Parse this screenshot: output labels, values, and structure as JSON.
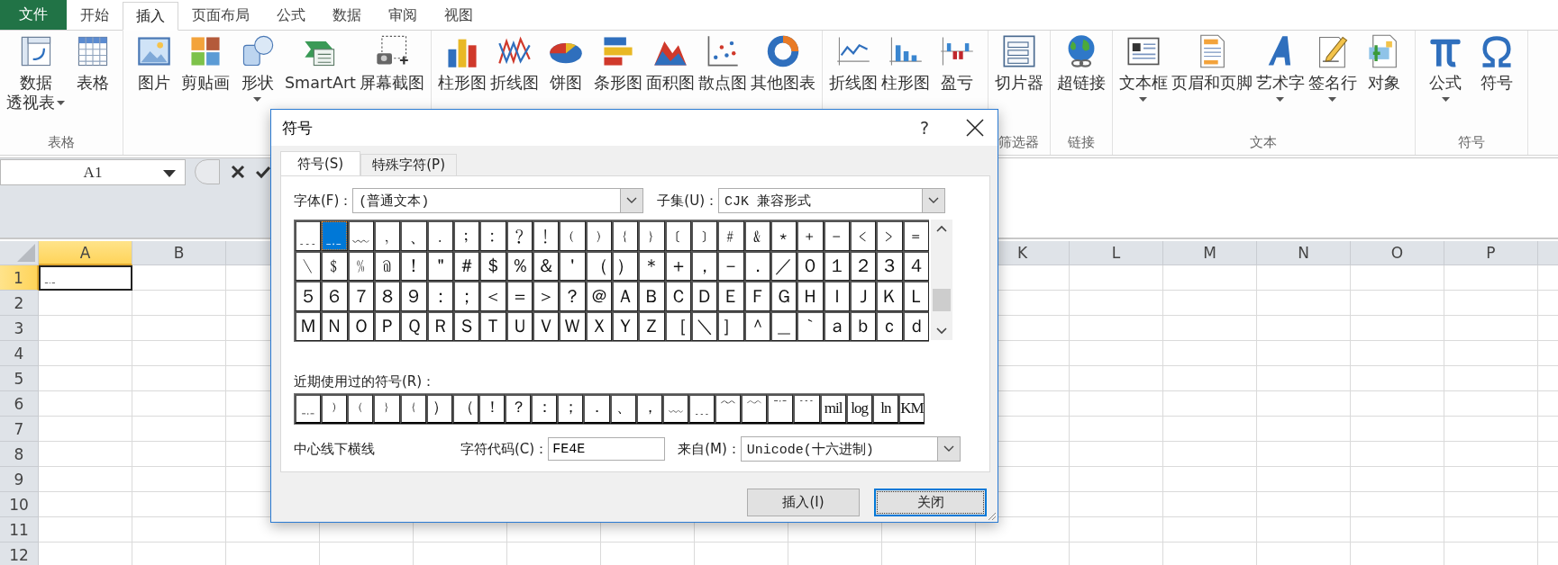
{
  "ribbon_tabs": [
    {
      "label": "文件",
      "kind": "file",
      "selected": false
    },
    {
      "label": "开始",
      "kind": "tab",
      "selected": false
    },
    {
      "label": "插入",
      "kind": "tab",
      "selected": true
    },
    {
      "label": "页面布局",
      "kind": "tab",
      "selected": false
    },
    {
      "label": "公式",
      "kind": "tab",
      "selected": false
    },
    {
      "label": "数据",
      "kind": "tab",
      "selected": false
    },
    {
      "label": "审阅",
      "kind": "tab",
      "selected": false
    },
    {
      "label": "视图",
      "kind": "tab",
      "selected": false
    }
  ],
  "ribbon_groups": [
    {
      "label": "表格",
      "items": [
        {
          "label": "数据",
          "label2": "透视表",
          "dropdown": true
        },
        {
          "label": "表格",
          "dropdown": false
        }
      ]
    },
    {
      "items": [
        {
          "label": "图片",
          "dropdown": false
        },
        {
          "label": "剪贴画",
          "dropdown": false
        },
        {
          "label": "形状",
          "dropdown": true
        },
        {
          "label": "SmartArt",
          "dropdown": false
        },
        {
          "label": "屏幕截图",
          "dropdown": false
        }
      ]
    },
    {
      "items": [
        {
          "label": "柱形图",
          "dropdown": false
        },
        {
          "label": "折线图",
          "dropdown": false
        },
        {
          "label": "饼图",
          "dropdown": false
        },
        {
          "label": "条形图",
          "dropdown": false
        },
        {
          "label": "面积图",
          "dropdown": false
        },
        {
          "label": "散点图",
          "dropdown": false
        },
        {
          "label": "其他图表",
          "dropdown": false
        }
      ]
    },
    {
      "items": [
        {
          "label": "折线图",
          "dropdown": false
        },
        {
          "label": "柱形图",
          "dropdown": false
        },
        {
          "label": "盈亏",
          "dropdown": false
        }
      ]
    },
    {
      "label": "筛选器",
      "items": [
        {
          "label": "切片器",
          "dropdown": false
        }
      ]
    },
    {
      "label": "链接",
      "items": [
        {
          "label": "超链接",
          "dropdown": false
        }
      ]
    },
    {
      "label": "文本",
      "items": [
        {
          "label": "文本框",
          "dropdown": true
        },
        {
          "label": "页眉和页脚",
          "dropdown": false
        },
        {
          "label": "艺术字",
          "dropdown": true
        },
        {
          "label": "签名行",
          "dropdown": true
        },
        {
          "label": "对象",
          "dropdown": false
        }
      ]
    },
    {
      "label": "符号",
      "items": [
        {
          "label": "公式",
          "dropdown": true
        },
        {
          "label": "符号",
          "dropdown": false
        }
      ]
    }
  ],
  "name_box": "A1",
  "sheet": {
    "columns_left": [
      {
        "label": "A",
        "selected": true
      },
      {
        "label": "B",
        "selected": false
      }
    ],
    "columns_right": [
      {
        "label": "K",
        "selected": false
      },
      {
        "label": "L",
        "selected": false
      },
      {
        "label": "M",
        "selected": false
      },
      {
        "label": "N",
        "selected": false
      },
      {
        "label": "O",
        "selected": false
      },
      {
        "label": "P",
        "selected": false
      }
    ],
    "rows": [
      {
        "label": "1",
        "selected": true,
        "cell_a": "﹎"
      },
      {
        "label": "2",
        "selected": false
      },
      {
        "label": "3",
        "selected": false
      },
      {
        "label": "4",
        "selected": false
      },
      {
        "label": "5",
        "selected": false
      },
      {
        "label": "6",
        "selected": false
      },
      {
        "label": "7",
        "selected": false
      },
      {
        "label": "8",
        "selected": false
      },
      {
        "label": "9",
        "selected": false
      },
      {
        "label": "10",
        "selected": false
      },
      {
        "label": "11",
        "selected": false
      },
      {
        "label": "12",
        "selected": false
      }
    ]
  },
  "dialog": {
    "title": "符号",
    "help": "?",
    "tabs": [
      {
        "label": "符号(S)",
        "selected": true
      },
      {
        "label": "特殊字符(P)",
        "selected": false
      }
    ],
    "font_label": "字体(F)：",
    "font_value": "(普通文本)",
    "subset_label": "子集(U)：",
    "subset_value": "CJK 兼容形式",
    "symbols": [
      {
        "c": "﹍",
        "selected": false
      },
      {
        "c": "﹎",
        "selected": true
      },
      {
        "c": "﹏",
        "selected": false
      },
      {
        "c": "﹐",
        "selected": false
      },
      {
        "c": "﹑",
        "selected": false
      },
      {
        "c": "﹒",
        "selected": false
      },
      {
        "c": "﹔",
        "selected": false
      },
      {
        "c": "﹕",
        "selected": false
      },
      {
        "c": "﹖",
        "selected": false
      },
      {
        "c": "﹗",
        "selected": false
      },
      {
        "c": "﹙",
        "selected": false
      },
      {
        "c": "﹚",
        "selected": false
      },
      {
        "c": "﹛",
        "selected": false
      },
      {
        "c": "﹜",
        "selected": false
      },
      {
        "c": "﹝",
        "selected": false
      },
      {
        "c": "﹞",
        "selected": false
      },
      {
        "c": "﹟",
        "selected": false
      },
      {
        "c": "﹠",
        "selected": false
      },
      {
        "c": "﹡",
        "selected": false
      },
      {
        "c": "﹢",
        "selected": false
      },
      {
        "c": "﹣",
        "selected": false
      },
      {
        "c": "﹤",
        "selected": false
      },
      {
        "c": "﹥",
        "selected": false
      },
      {
        "c": "﹦",
        "selected": false
      },
      {
        "c": "﹨",
        "selected": false
      },
      {
        "c": "﹩",
        "selected": false
      },
      {
        "c": "﹪",
        "selected": false
      },
      {
        "c": "﹫",
        "selected": false
      },
      {
        "c": "！",
        "selected": false
      },
      {
        "c": "＂",
        "selected": false
      },
      {
        "c": "＃",
        "selected": false
      },
      {
        "c": "＄",
        "selected": false
      },
      {
        "c": "％",
        "selected": false
      },
      {
        "c": "＆",
        "selected": false
      },
      {
        "c": "＇",
        "selected": false
      },
      {
        "c": "（",
        "selected": false
      },
      {
        "c": "）",
        "selected": false
      },
      {
        "c": "＊",
        "selected": false
      },
      {
        "c": "＋",
        "selected": false
      },
      {
        "c": "，",
        "selected": false
      },
      {
        "c": "－",
        "selected": false
      },
      {
        "c": "．",
        "selected": false
      },
      {
        "c": "／",
        "selected": false
      },
      {
        "c": "０",
        "selected": false
      },
      {
        "c": "１",
        "selected": false
      },
      {
        "c": "２",
        "selected": false
      },
      {
        "c": "３",
        "selected": false
      },
      {
        "c": "４",
        "selected": false
      },
      {
        "c": "５",
        "selected": false
      },
      {
        "c": "６",
        "selected": false
      },
      {
        "c": "７",
        "selected": false
      },
      {
        "c": "８",
        "selected": false
      },
      {
        "c": "９",
        "selected": false
      },
      {
        "c": "：",
        "selected": false
      },
      {
        "c": "；",
        "selected": false
      },
      {
        "c": "＜",
        "selected": false
      },
      {
        "c": "＝",
        "selected": false
      },
      {
        "c": "＞",
        "selected": false
      },
      {
        "c": "？",
        "selected": false
      },
      {
        "c": "＠",
        "selected": false
      },
      {
        "c": "Ａ",
        "selected": false
      },
      {
        "c": "Ｂ",
        "selected": false
      },
      {
        "c": "Ｃ",
        "selected": false
      },
      {
        "c": "Ｄ",
        "selected": false
      },
      {
        "c": "Ｅ",
        "selected": false
      },
      {
        "c": "Ｆ",
        "selected": false
      },
      {
        "c": "Ｇ",
        "selected": false
      },
      {
        "c": "Ｈ",
        "selected": false
      },
      {
        "c": "Ｉ",
        "selected": false
      },
      {
        "c": "Ｊ",
        "selected": false
      },
      {
        "c": "Ｋ",
        "selected": false
      },
      {
        "c": "Ｌ",
        "selected": false
      },
      {
        "c": "Ｍ",
        "selected": false
      },
      {
        "c": "Ｎ",
        "selected": false
      },
      {
        "c": "Ｏ",
        "selected": false
      },
      {
        "c": "Ｐ",
        "selected": false
      },
      {
        "c": "Ｑ",
        "selected": false
      },
      {
        "c": "Ｒ",
        "selected": false
      },
      {
        "c": "Ｓ",
        "selected": false
      },
      {
        "c": "Ｔ",
        "selected": false
      },
      {
        "c": "Ｕ",
        "selected": false
      },
      {
        "c": "Ｖ",
        "selected": false
      },
      {
        "c": "Ｗ",
        "selected": false
      },
      {
        "c": "Ｘ",
        "selected": false
      },
      {
        "c": "Ｙ",
        "selected": false
      },
      {
        "c": "Ｚ",
        "selected": false
      },
      {
        "c": "［",
        "selected": false
      },
      {
        "c": "＼",
        "selected": false
      },
      {
        "c": "］",
        "selected": false
      },
      {
        "c": "＾",
        "selected": false
      },
      {
        "c": "＿",
        "selected": false
      },
      {
        "c": "｀",
        "selected": false
      },
      {
        "c": "ａ",
        "selected": false
      },
      {
        "c": "ｂ",
        "selected": false
      },
      {
        "c": "ｃ",
        "selected": false
      },
      {
        "c": "ｄ",
        "selected": false
      }
    ],
    "recent_label": "近期使用过的符号(R)：",
    "recent": [
      "﹎",
      "﹚",
      "﹙",
      "﹜",
      "﹛",
      "）",
      "（",
      "！",
      "？",
      "：",
      "；",
      "．",
      "、",
      "，",
      "﹏",
      "﹍",
      "﹌",
      "﹋",
      "﹊",
      "﹉",
      "mil",
      "log",
      "ln",
      "KM"
    ],
    "char_name": "中心线下横线",
    "code_label": "字符代码(C)：",
    "code_value": "FE4E",
    "from_label": "来自(M)：",
    "from_value": "Unicode(十六进制)",
    "buttons": [
      {
        "label": "插入(I)",
        "focused": false
      },
      {
        "label": "关闭",
        "focused": true
      }
    ]
  }
}
